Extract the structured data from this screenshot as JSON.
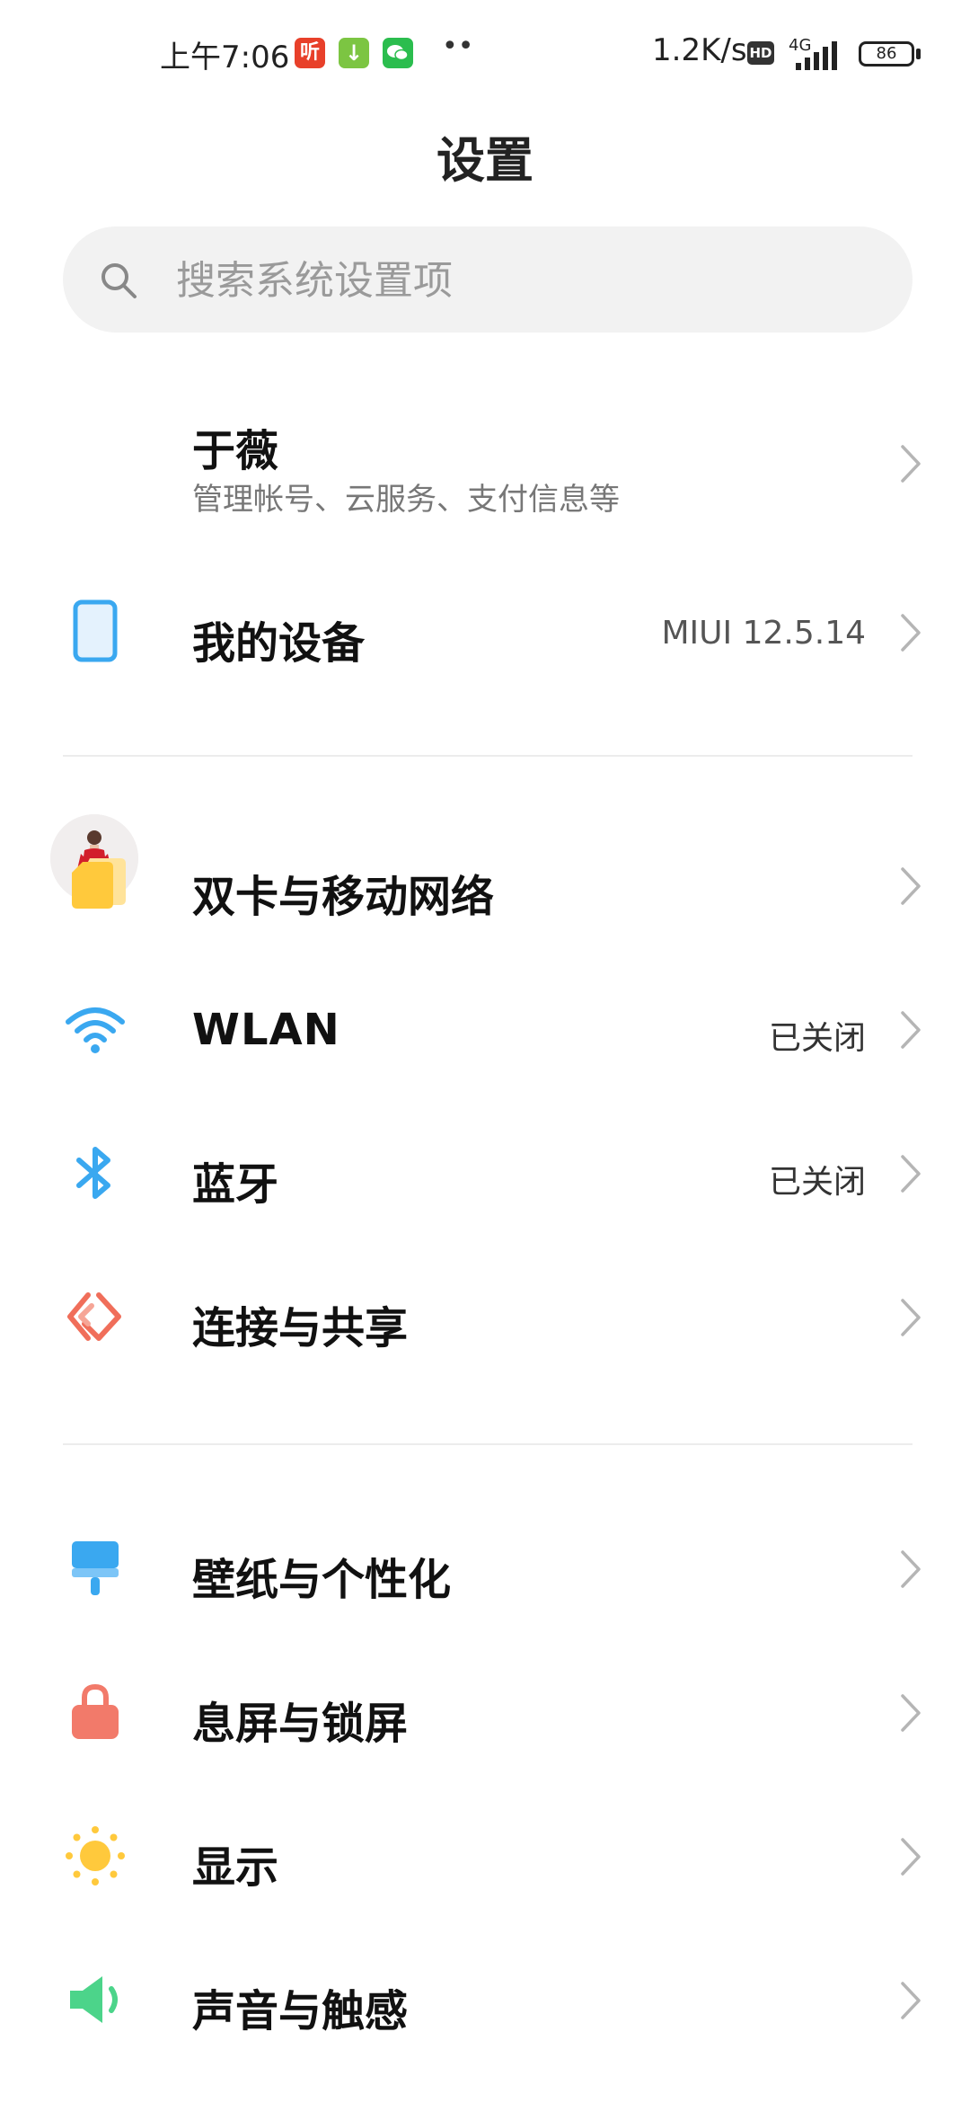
{
  "status_bar": {
    "time": "上午7:06",
    "app_icons": [
      {
        "name": "listen-app-icon",
        "label": "听",
        "color": "#e8402a"
      },
      {
        "name": "download-app-icon",
        "label": "↓",
        "color": "#7cc542"
      },
      {
        "name": "wechat-app-icon",
        "label": "",
        "color": "#2bbd4e"
      }
    ],
    "more_dots": "••",
    "network_speed": "1.2K/s",
    "hd_badge": "HD",
    "network_type": "4G",
    "battery": "86"
  },
  "header": {
    "title": "设置"
  },
  "search": {
    "placeholder": "搜索系统设置项"
  },
  "account": {
    "name": "于薇",
    "subtitle": "管理帐号、云服务、支付信息等"
  },
  "my_device": {
    "label": "我的设备",
    "value": "MIUI 12.5.14"
  },
  "section_network": [
    {
      "name": "dual-sim",
      "label": "双卡与移动网络",
      "value": "",
      "icon": "sim-card-icon",
      "color": "#ffc93c"
    },
    {
      "name": "wlan",
      "label": "WLAN",
      "value": "已关闭",
      "icon": "wifi-icon",
      "color": "#3aa8f0"
    },
    {
      "name": "bluetooth",
      "label": "蓝牙",
      "value": "已关闭",
      "icon": "bluetooth-icon",
      "color": "#3aa8f0"
    },
    {
      "name": "connection-sharing",
      "label": "连接与共享",
      "value": "",
      "icon": "share-icon",
      "color": "#f06e5a"
    }
  ],
  "section_personal": [
    {
      "name": "wallpaper",
      "label": "壁纸与个性化",
      "icon": "brush-icon",
      "color": "#3aa8f0"
    },
    {
      "name": "lock-screen",
      "label": "息屏与锁屏",
      "icon": "lock-icon",
      "color": "#f27a6a"
    },
    {
      "name": "display",
      "label": "显示",
      "icon": "sun-icon",
      "color": "#ffc93c"
    },
    {
      "name": "sound",
      "label": "声音与触感",
      "icon": "speaker-icon",
      "color": "#4cd48a"
    }
  ]
}
